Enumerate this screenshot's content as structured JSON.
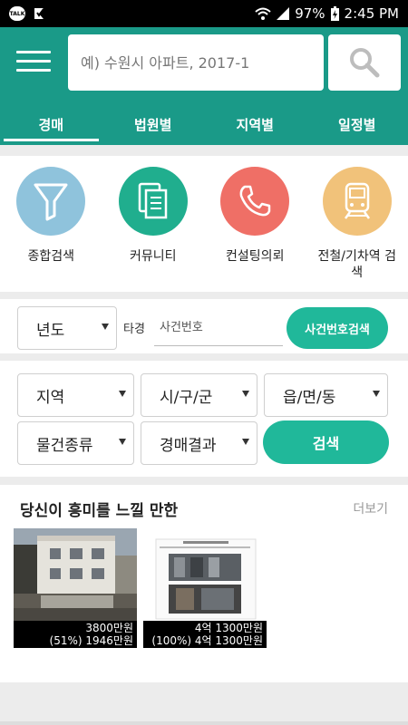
{
  "status_bar": {
    "talk_badge": "TALK",
    "battery": "97%",
    "time": "2:45 PM"
  },
  "header": {
    "search_placeholder": "예) 수원시 아파트, 2017-1",
    "tabs": [
      {
        "label": "경매",
        "active": true
      },
      {
        "label": "법원별",
        "active": false
      },
      {
        "label": "지역별",
        "active": false
      },
      {
        "label": "일정별",
        "active": false
      }
    ]
  },
  "quick_menu": [
    {
      "label": "종합검색",
      "icon": "funnel-icon",
      "color": "#8fc3dc"
    },
    {
      "label": "커뮤니티",
      "icon": "documents-icon",
      "color": "#20ae8e"
    },
    {
      "label": "컨설팅의뢰",
      "icon": "phone-icon",
      "color": "#ef6f66"
    },
    {
      "label": "전철/기차역 검색",
      "icon": "train-icon",
      "color": "#f1c27a"
    }
  ],
  "case_search": {
    "year_select": "년도",
    "tagyeong_label": "타경",
    "case_placeholder": "사건번호",
    "case_search_button": "사건번호검색"
  },
  "filters": {
    "region": "지역",
    "city": "시/구/군",
    "town": "읍/면/동",
    "property_type": "물건종류",
    "auction_result": "경매결과",
    "search_button": "검색"
  },
  "recommend": {
    "title": "당신이 흥미를 느낄 만한",
    "more": "더보기",
    "items": [
      {
        "price": "3800만원",
        "sub": "(51%) 1946만원"
      },
      {
        "price": "4억 1300만원",
        "sub": "(100%) 4억 1300만원"
      }
    ]
  },
  "colors": {
    "primary": "#1a9a88",
    "button": "#20b89a"
  }
}
